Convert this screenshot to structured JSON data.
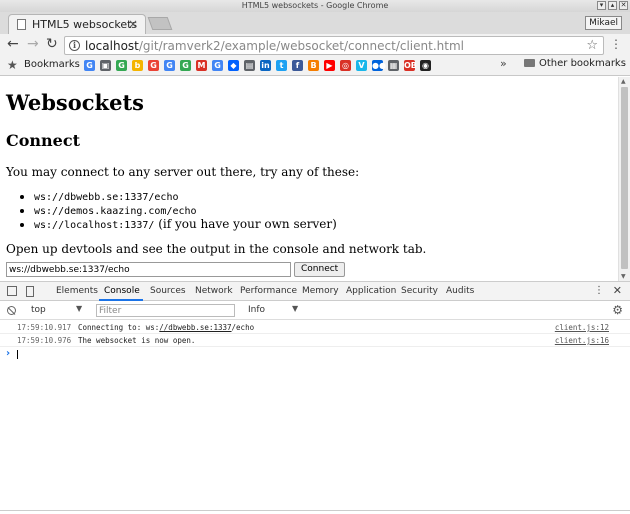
{
  "window": {
    "title": "HTML5 websockets - Google Chrome",
    "controls": [
      "▾",
      "▴",
      "✕"
    ]
  },
  "tab": {
    "title": "HTML5 websockets",
    "close": "×"
  },
  "profile": {
    "name": "Mikael"
  },
  "toolbar": {
    "back": "←",
    "forward": "→",
    "reload": "↻",
    "info": "i",
    "url_host": "localhost",
    "url_path": "/git/ramverk2/example/websocket/connect/client.html",
    "star": "☆",
    "menu": "⋮"
  },
  "bookmarks": {
    "label": "Bookmarks",
    "favicons": [
      {
        "glyph": "G",
        "color": "#4285f4"
      },
      {
        "glyph": "▣",
        "color": "#5f6368"
      },
      {
        "glyph": "G",
        "color": "#34a853"
      },
      {
        "glyph": "b",
        "color": "#f4b400"
      },
      {
        "glyph": "G",
        "color": "#ea4335"
      },
      {
        "glyph": "G",
        "color": "#4285f4"
      },
      {
        "glyph": "G",
        "color": "#34a853"
      },
      {
        "glyph": "M",
        "color": "#d93025"
      },
      {
        "glyph": "G",
        "color": "#4285f4"
      },
      {
        "glyph": "◆",
        "color": "#0061fe"
      },
      {
        "glyph": "▤",
        "color": "#5f6368"
      },
      {
        "glyph": "in",
        "color": "#0a66c2"
      },
      {
        "glyph": "t",
        "color": "#1da1f2"
      },
      {
        "glyph": "f",
        "color": "#3b5998"
      },
      {
        "glyph": "B",
        "color": "#f57d00"
      },
      {
        "glyph": "▶",
        "color": "#ff0000"
      },
      {
        "glyph": "◎",
        "color": "#d93025"
      },
      {
        "glyph": "V",
        "color": "#1ab7ea"
      },
      {
        "glyph": "●●",
        "color": "#0063dc"
      },
      {
        "glyph": "▦",
        "color": "#5f6368"
      },
      {
        "glyph": "OB",
        "color": "#d93025"
      },
      {
        "glyph": "◉",
        "color": "#222222"
      }
    ],
    "more": "»",
    "other": "Other bookmarks"
  },
  "page": {
    "h1": "Websockets",
    "h2": "Connect",
    "intro": "You may connect to any server out there, try any of these:",
    "servers": [
      {
        "url": "ws://dbwebb.se:1337/echo",
        "note": ""
      },
      {
        "url": "ws://demos.kaazing.com/echo",
        "note": ""
      },
      {
        "url": "ws://localhost:1337/",
        "note": " (if you have your own server)"
      }
    ],
    "devtools_hint": "Open up devtools and see the output in the console and network tab.",
    "url_value": "ws://dbwebb.se:1337/echo",
    "connect_label": "Connect"
  },
  "devtools": {
    "tabs": [
      "Elements",
      "Console",
      "Sources",
      "Network",
      "Performance",
      "Memory",
      "Application",
      "Security",
      "Audits"
    ],
    "active_tab": "Console",
    "context": "top",
    "filter_placeholder": "Filter",
    "level": "Info",
    "accent": "#1a73e8",
    "logs": [
      {
        "time": "17:59:10.917",
        "pre": "Connecting to: ws:",
        "link": "//dbwebb.se:1337",
        "post": "/echo",
        "source": "client.js:12"
      },
      {
        "time": "17:59:10.976",
        "pre": "The websocket is now open.",
        "link": "",
        "post": "",
        "source": "client.js:16"
      }
    ],
    "prompt": "›"
  }
}
